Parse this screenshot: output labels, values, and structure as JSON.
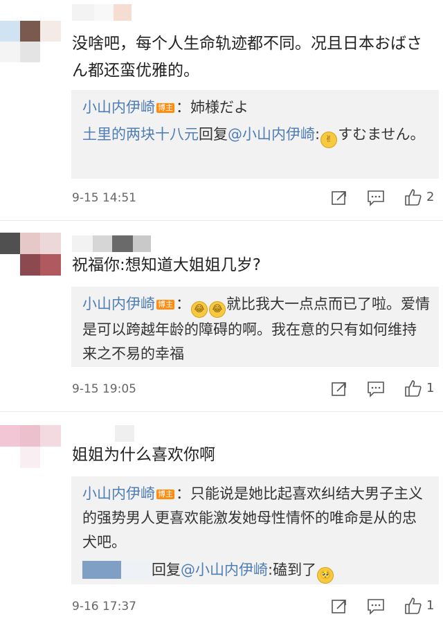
{
  "comments": [
    {
      "text": "没啥吧，每个人生命轨迹都不同。况且日本おばさん都还蛮优雅的。",
      "replies": [
        {
          "user": "小山内伊崎",
          "badge": "博主",
          "sep": "：",
          "text": "姉様だよ"
        },
        {
          "user": "土里的两块十八元",
          "verb": "回复",
          "mention": "@小山内伊崎",
          "sep": ":",
          "emoji": "clap-hands-emoji",
          "text": "すむません。"
        }
      ],
      "time": "9-15 14:51",
      "likes": "2"
    },
    {
      "text": "祝福你:想知道大姐姐几岁?",
      "replies": [
        {
          "user": "小山内伊崎",
          "badge": "博主",
          "sep": "：",
          "emojis": [
            "laugh-cry-emoji",
            "laugh-cry-emoji"
          ],
          "text": "就比我大一点点而已了啦。爱情是可以跨越年龄的障碍的啊。我在意的只有如何维持来之不易的幸福"
        }
      ],
      "time": "9-15 19:05",
      "likes": "1"
    },
    {
      "text": "姐姐为什么喜欢你啊",
      "replies": [
        {
          "user": "小山内伊崎",
          "badge": "博主",
          "sep": "：",
          "text": "只能说是她比起喜欢纠结大男子主义的强势男人更喜欢能激发她母性情怀的唯命是从的忠犬吧。"
        },
        {
          "verb": "回复",
          "mention": "@小山内伊崎",
          "sep": ":",
          "text": "磕到了",
          "emoji": "pleading-face-emoji"
        }
      ],
      "time": "9-16 17:37",
      "likes": "1"
    }
  ],
  "icons": {
    "share": "share-icon",
    "comment": "comment-icon",
    "like": "thumbs-up-icon"
  },
  "colors": {
    "link": "#4f7db5",
    "badge": "#ff8b0f",
    "reply_bg": "#f2f2f2"
  }
}
